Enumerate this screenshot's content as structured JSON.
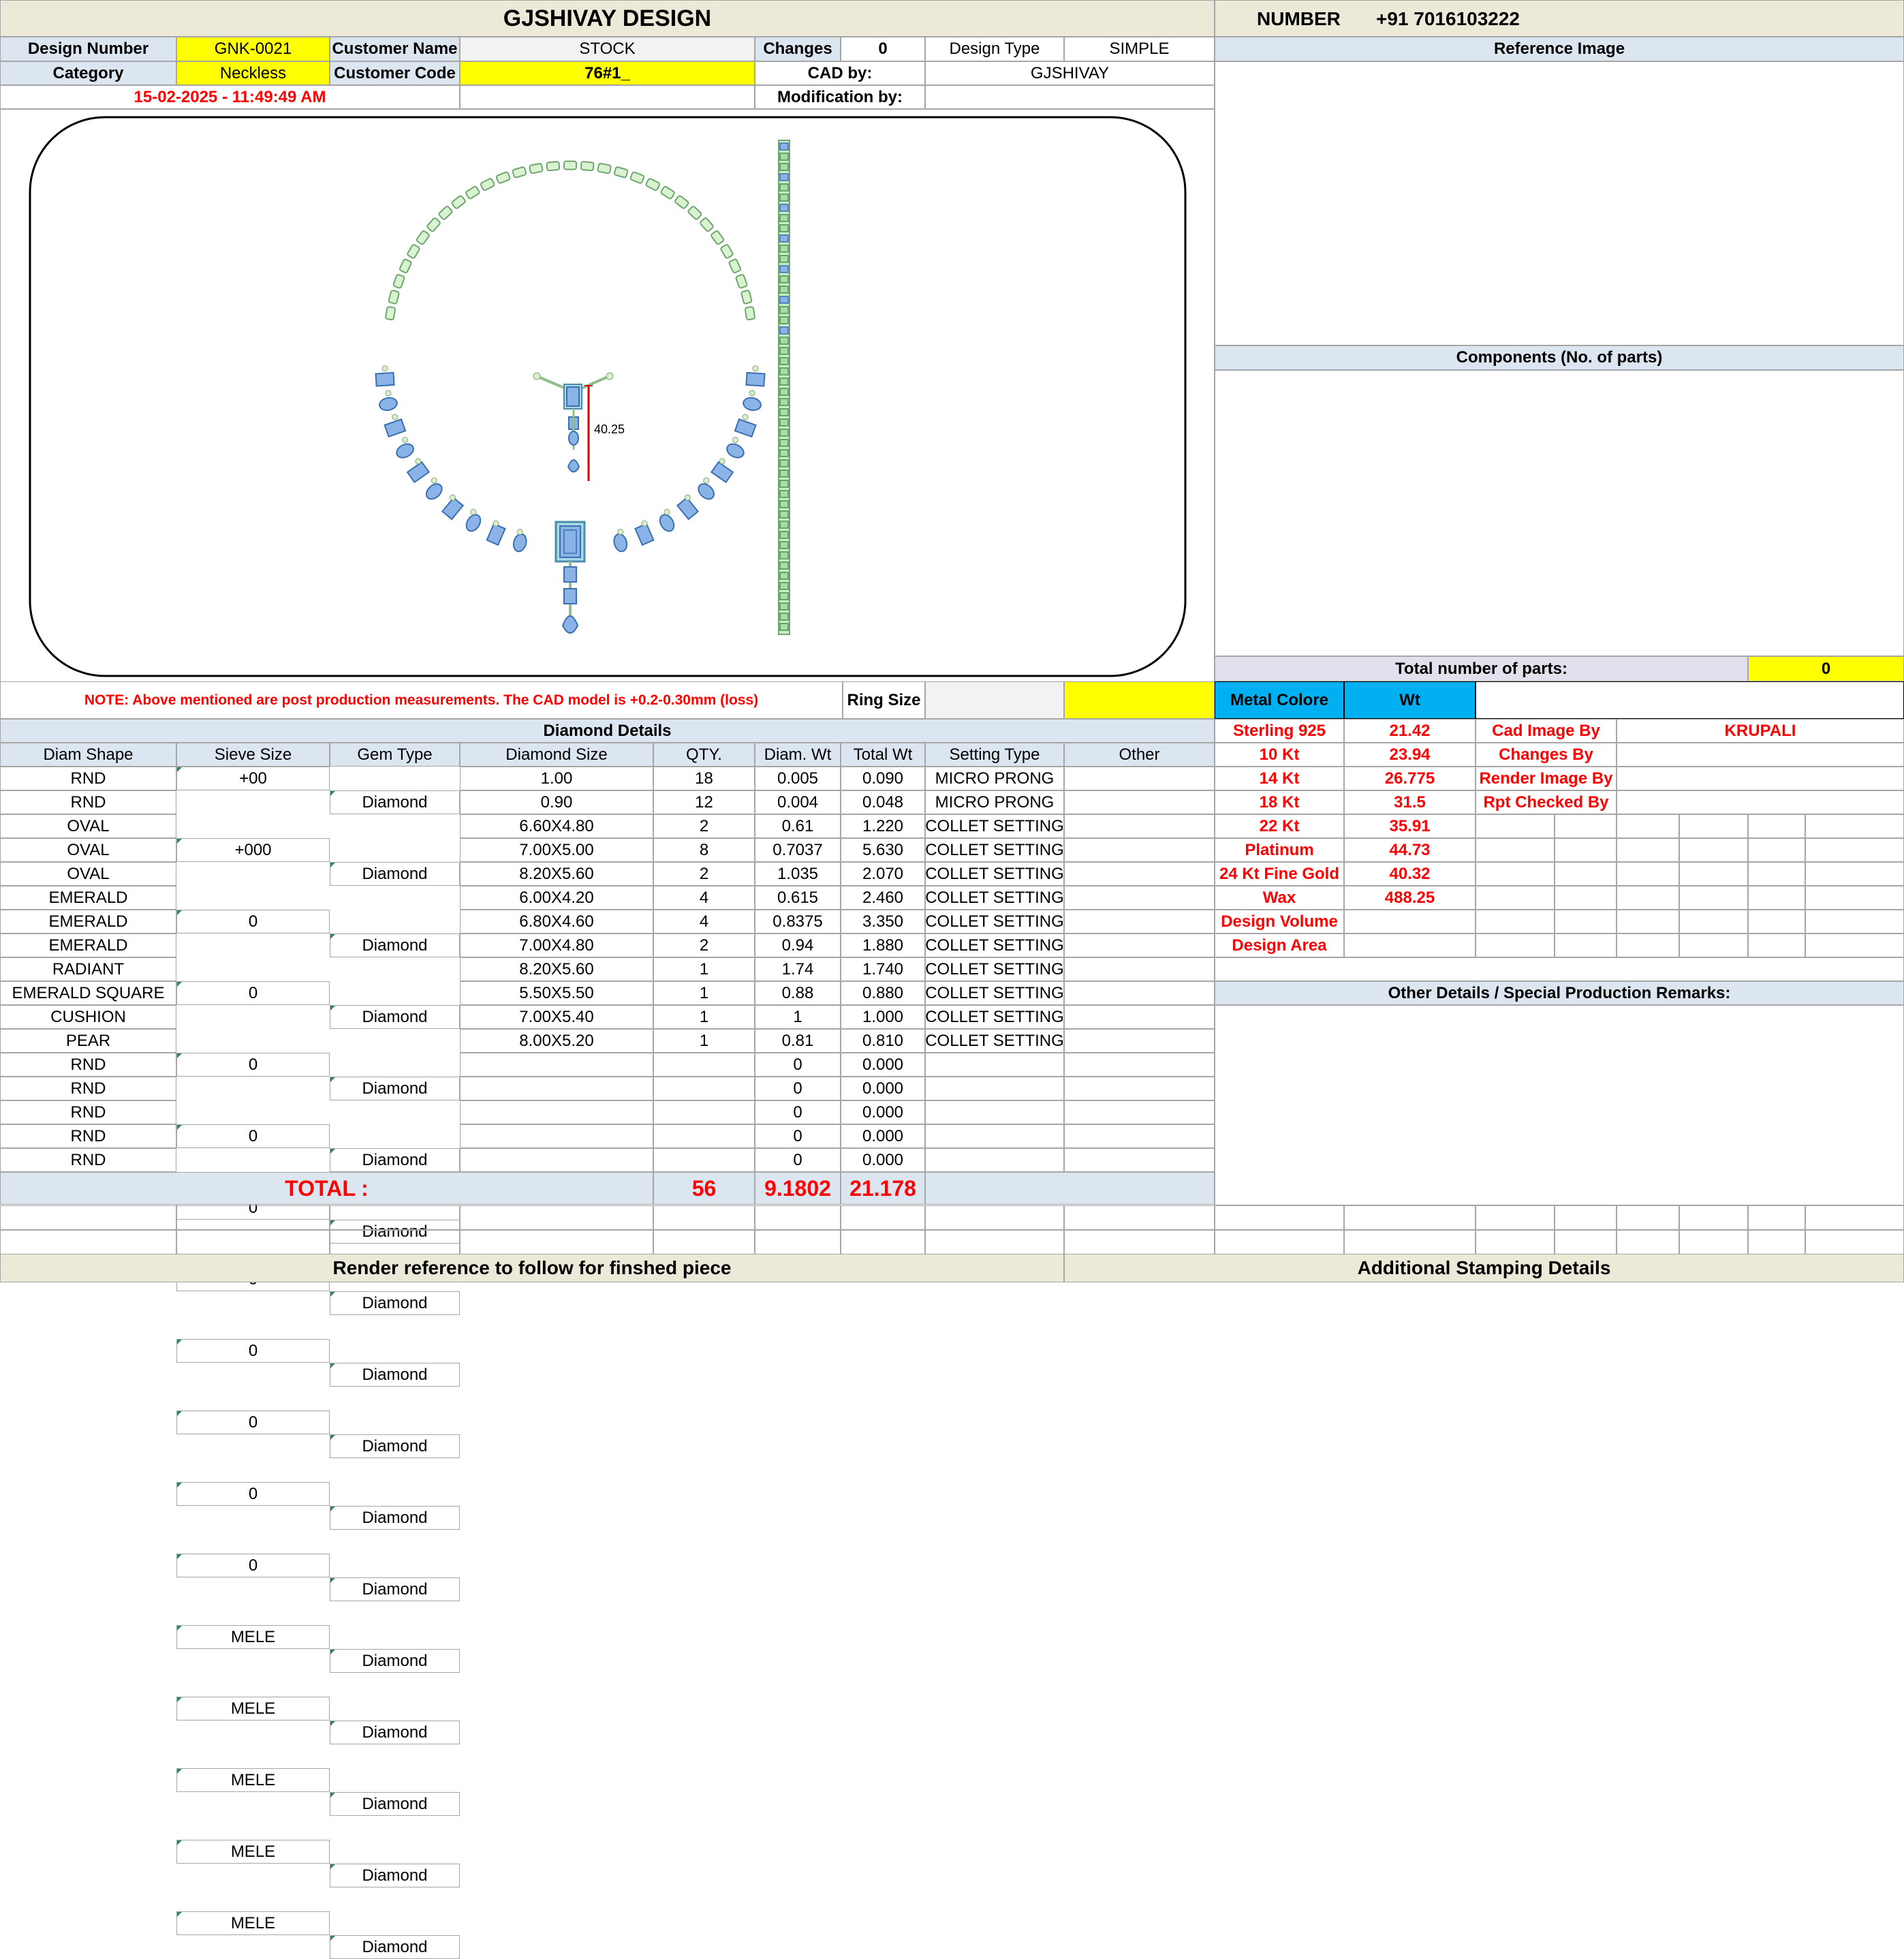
{
  "header": {
    "title": "GJSHIVAY DESIGN",
    "number_label": "NUMBER",
    "number_value": "+91 7016103222"
  },
  "info": {
    "design_number_label": "Design Number",
    "design_number": "GNK-0021",
    "customer_name_label": "Customer Name",
    "customer_name": "STOCK",
    "changes_label": "Changes",
    "changes": "0",
    "design_type_label": "Design Type",
    "design_type": "SIMPLE",
    "category_label": "Category",
    "category": "Neckless",
    "customer_code_label": "Customer Code",
    "customer_code": "76#1_",
    "cad_by_label": "CAD by:",
    "cad_by": "GJSHIVAY",
    "timestamp": "15-02-2025 - 11:49:49 AM",
    "modification_label": "Modification by:"
  },
  "drawing": {
    "dimension": "40.25"
  },
  "note": {
    "text": "NOTE: Above mentioned are post production measurements. The CAD model is +0.2-0.30mm (loss)",
    "ring_size_label": "Ring Size"
  },
  "right_panel": {
    "reference_image_label": "Reference Image",
    "components_label": "Components (No. of parts)",
    "total_parts_label": "Total number of parts:",
    "total_parts": "0",
    "other_details_label": "Other Details / Special Production Remarks:"
  },
  "metal": {
    "header_color": "Metal Colore",
    "header_wt": "Wt",
    "rows": [
      {
        "name": "Sterling 925",
        "wt": "21.42",
        "label": "Cad Image By",
        "value": "KRUPALI"
      },
      {
        "name": "10 Kt",
        "wt": "23.94",
        "label": "Changes By",
        "value": ""
      },
      {
        "name": "14 Kt",
        "wt": "26.775",
        "label": "Render Image By",
        "value": ""
      },
      {
        "name": "18 Kt",
        "wt": "31.5",
        "label": "Rpt Checked By",
        "value": ""
      },
      {
        "name": "22 Kt",
        "wt": "35.91",
        "label": "",
        "value": ""
      },
      {
        "name": "Platinum",
        "wt": "44.73",
        "label": "",
        "value": ""
      },
      {
        "name": "24 Kt Fine Gold",
        "wt": "40.32",
        "label": "",
        "value": ""
      },
      {
        "name": "Wax",
        "wt": "488.25",
        "label": "",
        "value": ""
      },
      {
        "name": "Design Volume",
        "wt": "",
        "label": "",
        "value": ""
      },
      {
        "name": "Design Area",
        "wt": "",
        "label": "",
        "value": ""
      }
    ]
  },
  "diamonds": {
    "title": "Diamond Details",
    "columns": [
      "Diam Shape",
      "Sieve Size",
      "Gem Type",
      "Diamond Size",
      "QTY.",
      "Diam. Wt",
      "Total Wt",
      "Setting Type",
      "Other"
    ],
    "rows": [
      [
        "RND",
        "+00",
        "Diamond",
        "1.00",
        "18",
        "0.005",
        "0.090",
        "MICRO PRONG"
      ],
      [
        "RND",
        "+000",
        "Diamond",
        "0.90",
        "12",
        "0.004",
        "0.048",
        "MICRO PRONG"
      ],
      [
        "OVAL",
        "0",
        "Diamond",
        "6.60X4.80",
        "2",
        "0.61",
        "1.220",
        "COLLET SETTING"
      ],
      [
        "OVAL",
        "0",
        "Diamond",
        "7.00X5.00",
        "8",
        "0.7037",
        "5.630",
        "COLLET SETTING"
      ],
      [
        "OVAL",
        "0",
        "Diamond",
        "8.20X5.60",
        "2",
        "1.035",
        "2.070",
        "COLLET SETTING"
      ],
      [
        "EMERALD",
        "0",
        "Diamond",
        "6.00X4.20",
        "4",
        "0.615",
        "2.460",
        "COLLET SETTING"
      ],
      [
        "EMERALD",
        "0",
        "Diamond",
        "6.80X4.60",
        "4",
        "0.8375",
        "3.350",
        "COLLET SETTING"
      ],
      [
        "EMERALD",
        "0",
        "Diamond",
        "7.00X4.80",
        "2",
        "0.94",
        "1.880",
        "COLLET SETTING"
      ],
      [
        "RADIANT",
        "0",
        "Diamond",
        "8.20X5.60",
        "1",
        "1.74",
        "1.740",
        "COLLET SETTING"
      ],
      [
        "EMERALD SQUARE",
        "0",
        "Diamond",
        "5.50X5.50",
        "1",
        "0.88",
        "0.880",
        "COLLET SETTING"
      ],
      [
        "CUSHION",
        "0",
        "Diamond",
        "7.00X5.40",
        "1",
        "1",
        "1.000",
        "COLLET SETTING"
      ],
      [
        "PEAR",
        "0",
        "Diamond",
        "8.00X5.20",
        "1",
        "0.81",
        "0.810",
        "COLLET SETTING"
      ],
      [
        "RND",
        "MELE",
        "Diamond",
        "",
        "",
        "0",
        "0.000",
        ""
      ],
      [
        "RND",
        "MELE",
        "Diamond",
        "",
        "",
        "0",
        "0.000",
        ""
      ],
      [
        "RND",
        "MELE",
        "Diamond",
        "",
        "",
        "0",
        "0.000",
        ""
      ],
      [
        "RND",
        "MELE",
        "Diamond",
        "",
        "",
        "0",
        "0.000",
        ""
      ],
      [
        "RND",
        "MELE",
        "Diamond",
        "",
        "",
        "0",
        "0.000",
        ""
      ]
    ],
    "total_label": "TOTAL :",
    "total_qty": "56",
    "total_diam_wt": "9.1802",
    "total_wt": "21.178"
  },
  "footer": {
    "render_reference": "Render reference to follow for finshed piece",
    "stamping": "Additional Stamping Details"
  }
}
